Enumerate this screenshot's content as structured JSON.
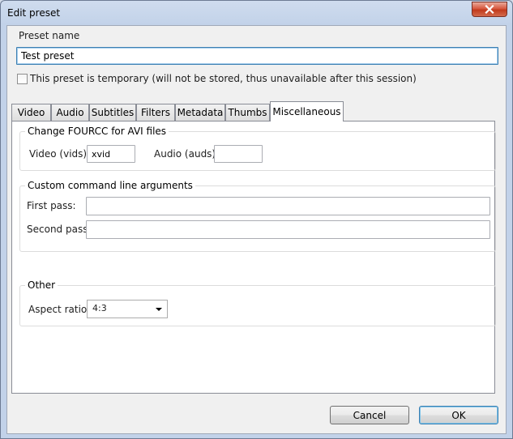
{
  "window": {
    "title": "Edit preset"
  },
  "preset": {
    "name_label": "Preset name",
    "name_value": "Test preset",
    "temporary_label": "This preset is temporary (will not be stored, thus unavailable after this session)"
  },
  "tabs": [
    {
      "label": "Video"
    },
    {
      "label": "Audio"
    },
    {
      "label": "Subtitles"
    },
    {
      "label": "Filters"
    },
    {
      "label": "Metadata"
    },
    {
      "label": "Thumbs"
    },
    {
      "label": "Miscellaneous"
    }
  ],
  "fourcc": {
    "title": "Change FOURCC for AVI files",
    "video_label": "Video (vids):",
    "video_value": "xvid",
    "audio_label": "Audio (auds):",
    "audio_value": ""
  },
  "custom_args": {
    "title": "Custom command line arguments",
    "first_label": "First pass:",
    "first_value": "",
    "second_label": "Second pass:",
    "second_value": ""
  },
  "other": {
    "title": "Other",
    "aspect_label": "Aspect ratio:",
    "aspect_value": "4:3"
  },
  "buttons": {
    "cancel": "Cancel",
    "ok": "OK"
  }
}
